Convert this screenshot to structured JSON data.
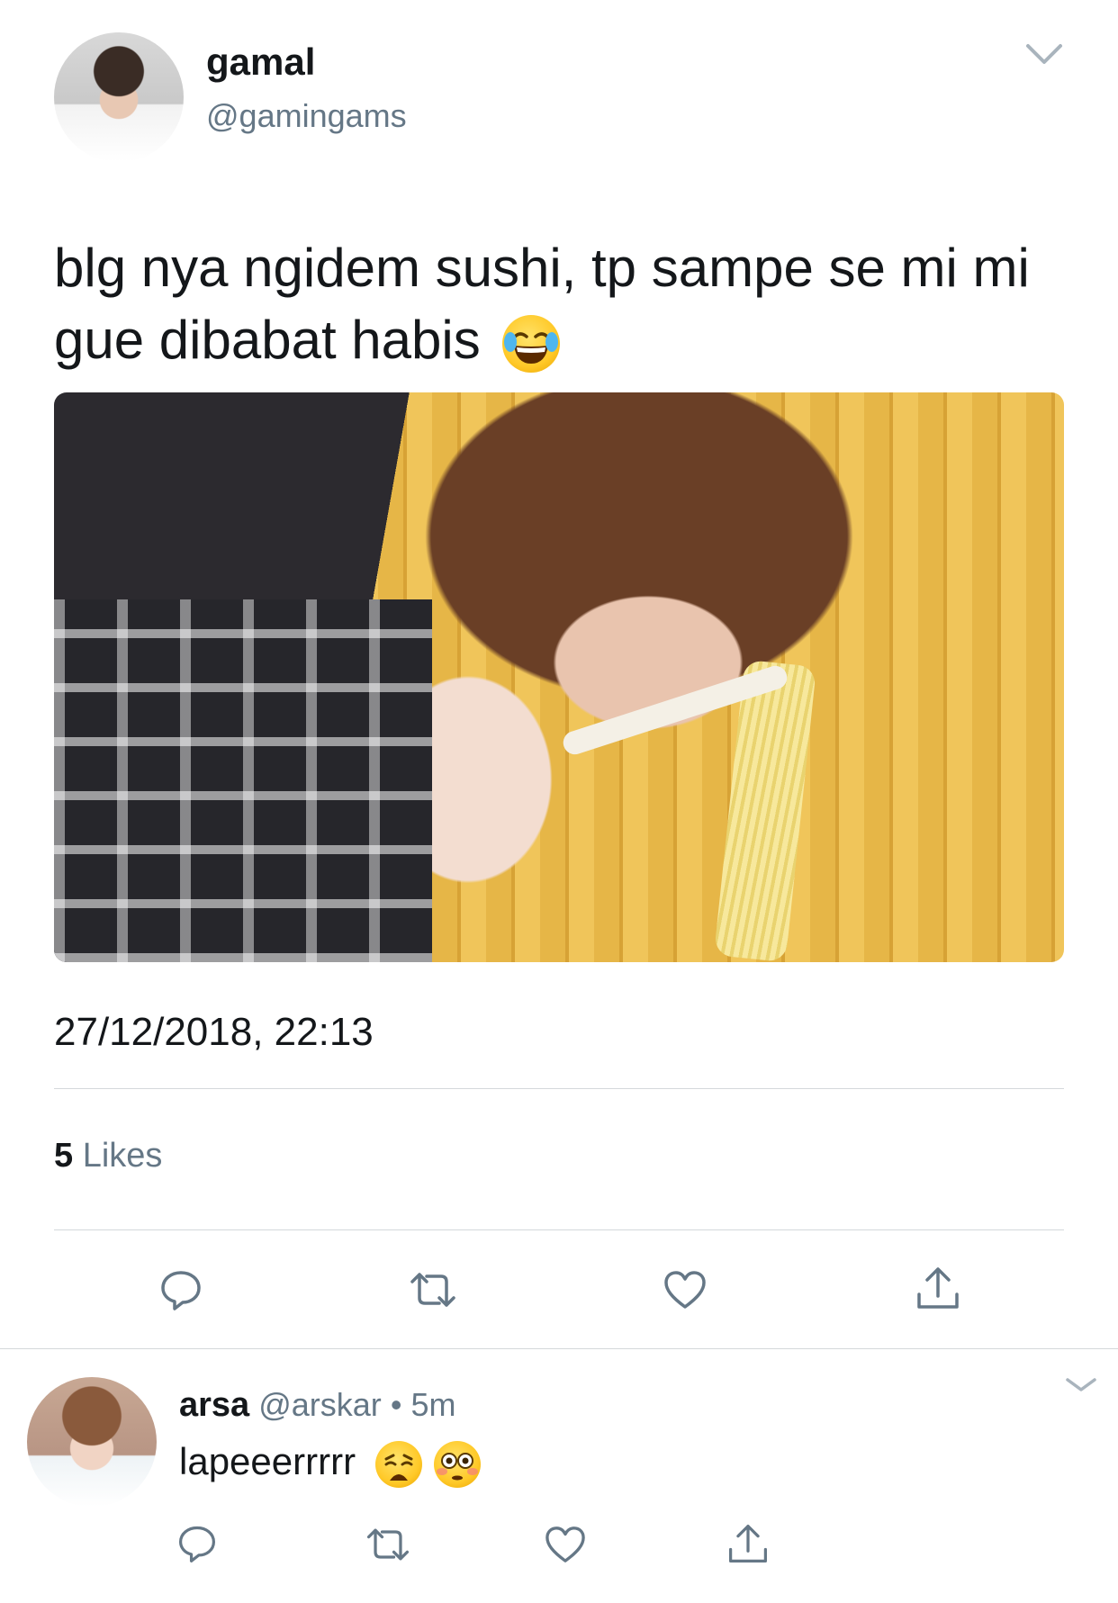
{
  "tweet": {
    "author_name": "gamal",
    "author_handle": "@gamingams",
    "text_line1": "blg nya ngidem sushi, tp sampe se mi mi",
    "text_line2": "gue dibabat habis",
    "emoji": "face-with-tears-of-joy",
    "timestamp": "27/12/2018, 22:13",
    "likes_count": "5",
    "likes_label": "Likes",
    "actions": [
      "reply-icon",
      "retweet-icon",
      "like-icon",
      "share-icon"
    ]
  },
  "reply": {
    "author_name": "arsa",
    "author_handle": "@arskar",
    "separator": "•",
    "time": "5m",
    "text": "lapeeerrrrr",
    "emojis": [
      "weary-face",
      "flushed-face"
    ],
    "actions": [
      "reply-icon",
      "retweet-icon",
      "like-icon",
      "share-icon"
    ]
  },
  "colors": {
    "text": "#14171a",
    "secondary": "#657786",
    "divider": "#d4d8db",
    "icon": "#657786"
  }
}
